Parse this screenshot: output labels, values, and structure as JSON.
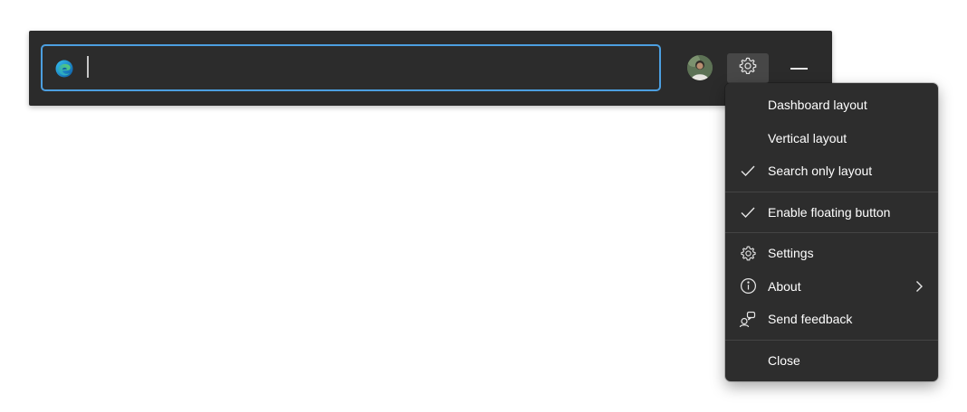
{
  "search": {
    "value": "",
    "placeholder": ""
  },
  "icons": {
    "browser": "edge-logo-icon",
    "avatar": "user-avatar",
    "settings": "gear-icon",
    "minimize": "minimize-icon"
  },
  "colors": {
    "bar_background": "#2b2b2b",
    "search_border": "#4c9fe0",
    "menu_background": "#2d2d2d",
    "text": "#ffffff"
  },
  "menu": {
    "group_layout": [
      {
        "label": "Dashboard layout",
        "checked": false
      },
      {
        "label": "Vertical layout",
        "checked": false
      },
      {
        "label": "Search only layout",
        "checked": true
      }
    ],
    "group_options": [
      {
        "label": "Enable floating button",
        "checked": true
      }
    ],
    "group_actions": [
      {
        "label": "Settings",
        "icon": "gear-icon"
      },
      {
        "label": "About",
        "icon": "info-icon",
        "submenu": true
      },
      {
        "label": "Send feedback",
        "icon": "feedback-icon"
      }
    ],
    "close_label": "Close"
  }
}
